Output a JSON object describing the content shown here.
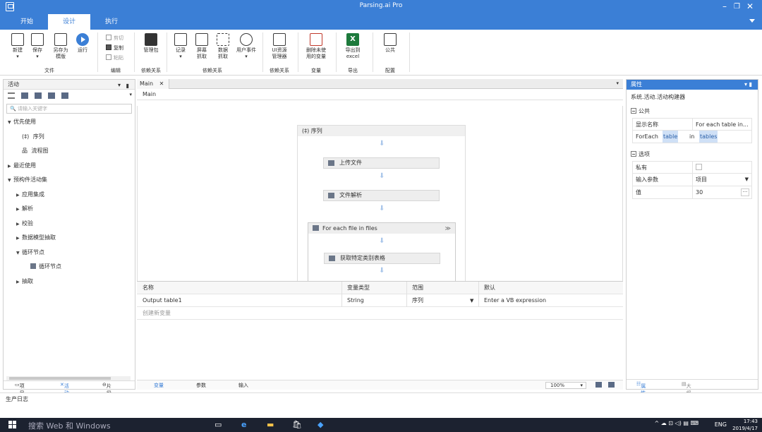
{
  "window": {
    "title": "Parsing.ai Pro"
  },
  "menu": {
    "tabs": [
      "开始",
      "设计",
      "执行"
    ],
    "active": 1
  },
  "ribbon": {
    "buttons": [
      {
        "label": "新建",
        "sub": "▾"
      },
      {
        "label": "保存",
        "sub": "▾"
      },
      {
        "label": "另存为",
        "sub": "模版"
      },
      {
        "label": "运行",
        "sub": ""
      },
      {
        "label": "管理包",
        "sub": ""
      },
      {
        "label": "记录",
        "sub": "▾"
      },
      {
        "label": "屏幕",
        "sub": "抓取"
      },
      {
        "label": "数据",
        "sub": "抓取"
      },
      {
        "label": "用户事件",
        "sub": "▾"
      },
      {
        "label": "UI资源",
        "sub": "管理器"
      },
      {
        "label": "删除未使",
        "sub": "用的变量"
      },
      {
        "label": "导出到",
        "sub": "excel"
      },
      {
        "label": "公共",
        "sub": ""
      }
    ],
    "edit_items": [
      "剪切",
      "复制",
      "粘贴"
    ],
    "groups": [
      "文件",
      "编辑",
      "依赖关系",
      "依赖关系",
      "依赖关系",
      "变量",
      "导出",
      "配置"
    ]
  },
  "activities": {
    "title": "活动",
    "search_placeholder": "请输入关键字",
    "tree": [
      {
        "label": "优先使用",
        "toggle": "▼",
        "level": 0
      },
      {
        "label": "序列",
        "toggle": "",
        "level": 1,
        "icon": "(‡)"
      },
      {
        "label": "流程图",
        "toggle": "",
        "level": 1,
        "icon": "品"
      },
      {
        "label": "最近使用",
        "toggle": "▶",
        "level": 0
      },
      {
        "label": "预构件活动集",
        "toggle": "▼",
        "level": 0
      },
      {
        "label": "应用集成",
        "toggle": "▶",
        "level": 1
      },
      {
        "label": "解析",
        "toggle": "▶",
        "level": 1
      },
      {
        "label": "校验",
        "toggle": "▶",
        "level": 1
      },
      {
        "label": "数据模型抽取",
        "toggle": "▶",
        "level": 1
      },
      {
        "label": "循环节点",
        "toggle": "▼",
        "level": 1
      },
      {
        "label": "循环节点",
        "toggle": "",
        "level": 2,
        "icon": "sq"
      },
      {
        "label": "抽取",
        "toggle": "▶",
        "level": 1
      }
    ],
    "bottom_tabs": [
      "项目",
      "活动",
      "片段"
    ]
  },
  "designer": {
    "doc_tab": "Main",
    "breadcrumb": "Main",
    "sequence_title": "序列",
    "activities": [
      "上传文件",
      "文件解析"
    ],
    "foreach_title": "For each file in files",
    "inner_activity": "获取特定类别表格"
  },
  "variables": {
    "headers": [
      "名称",
      "变量类型",
      "范围",
      "默认"
    ],
    "rows": [
      [
        "Output table1",
        "String",
        "序列",
        "Enter a VB expression"
      ]
    ],
    "create_new": "创建新变量",
    "bottom_tabs": [
      "变量",
      "参数",
      "输入"
    ],
    "zoom": "100%"
  },
  "properties": {
    "title": "属性",
    "subtitle": "系统.活动.活动构建器",
    "section_common": "公共",
    "display_name_key": "显示名称",
    "display_name_val": "For each table in...",
    "foreach_key": "ForEach",
    "foreach_item": "table",
    "foreach_in": "in",
    "foreach_collection": "tables",
    "section_options": "选项",
    "private_key": "私有",
    "input_key": "输入参数",
    "input_val": "项目",
    "value_key": "值",
    "value_val": "30",
    "bottom_tabs": [
      "属性",
      "大纲"
    ]
  },
  "log": {
    "label": "生产日志"
  },
  "taskbar": {
    "search": "搜索 Web 和 Windows",
    "lang": "ENG",
    "time": "17:43",
    "date": "2019/4/17"
  }
}
